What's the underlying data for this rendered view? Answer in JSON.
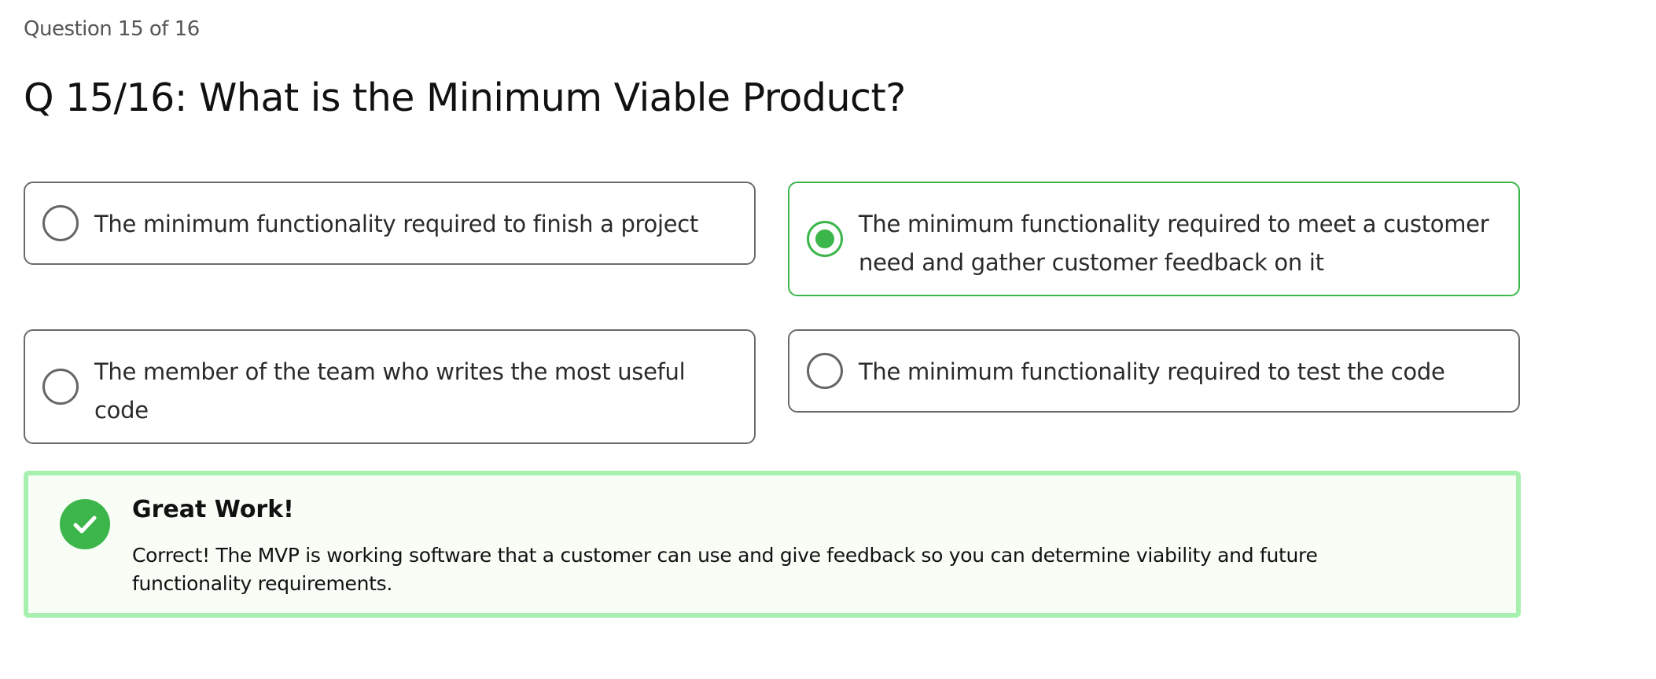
{
  "progress": "Question 15 of 16",
  "question": "Q 15/16: What is the Minimum Viable Product?",
  "options": [
    {
      "label": "The minimum functionality required to finish a project",
      "selected": false
    },
    {
      "label": "The minimum functionality required to meet a customer need and gather customer feedback on it",
      "selected": true
    },
    {
      "label": "The member of the team who writes the most useful code",
      "selected": false
    },
    {
      "label": "The minimum functionality required to test the code",
      "selected": false
    }
  ],
  "feedback": {
    "icon": "check-circle-icon",
    "title": "Great Work!",
    "body": "Correct! The MVP is working software that a customer can use and give feedback so you can determine viability and future functionality requirements."
  },
  "colors": {
    "accent": "#3cb64a",
    "feedback_border": "#a8f0b0",
    "feedback_bg": "#f8fdf6"
  }
}
